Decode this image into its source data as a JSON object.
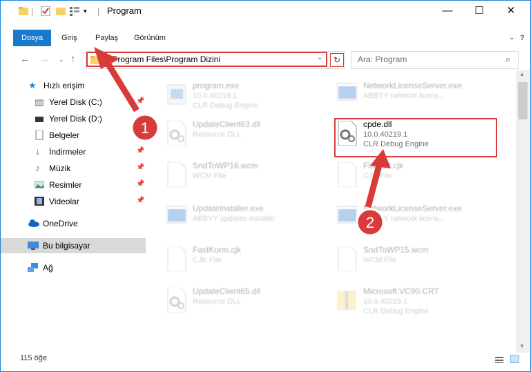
{
  "title": "Program",
  "tabs": [
    "Dosya",
    "Giriş",
    "Paylaş",
    "Görünüm"
  ],
  "window_buttons": {
    "minimize": "—",
    "maximize": "☐",
    "close": "✕"
  },
  "address": {
    "path": "C:\\Program Files\\Program Dizini"
  },
  "search": {
    "placeholder": "Ara: Program"
  },
  "sidebar": [
    {
      "label": "Hızlı erişim",
      "icon": "star-icon",
      "pinned": false
    },
    {
      "label": "Yerel Disk (C:)",
      "icon": "drive-icon",
      "pinned": true
    },
    {
      "label": "Yerel Disk (D:)",
      "icon": "drive-icon",
      "pinned": false
    },
    {
      "label": "Belgeler",
      "icon": "document-icon",
      "pinned": false
    },
    {
      "label": "İndirmeler",
      "icon": "download-icon",
      "pinned": true
    },
    {
      "label": "Müzik",
      "icon": "music-icon",
      "pinned": true
    },
    {
      "label": "Resimler",
      "icon": "pictures-icon",
      "pinned": true
    },
    {
      "label": "Videolar",
      "icon": "video-icon",
      "pinned": true
    },
    {
      "label": "OneDrive",
      "icon": "cloud-icon",
      "pinned": false
    },
    {
      "label": "Bu bilgisayar",
      "icon": "computer-icon",
      "pinned": false
    },
    {
      "label": "Ağ",
      "icon": "network-icon",
      "pinned": false
    }
  ],
  "files": [
    {
      "name": "program.exe",
      "line1": "10.0.40219.1",
      "line2": "CLR Debug Engine",
      "icon": "exe-icon"
    },
    {
      "name": "NetworkLicenseServer.exe",
      "line1": "ABBYY network licens...",
      "line2": "",
      "icon": "window-app-icon"
    },
    {
      "name": "UpdateClient63.dll",
      "line1": "Resource DLL",
      "line2": "",
      "icon": "gear-file-icon"
    },
    {
      "name": "cpde.dll",
      "line1": "10.0.40219.1",
      "line2": "CLR Debug Engine",
      "icon": "gear-file-icon"
    },
    {
      "name": "SndToWP16.wcm",
      "line1": "WCM File",
      "line2": "",
      "icon": "blank-file-icon"
    },
    {
      "name": "Flaroint.cjk",
      "line1": "CJK File",
      "line2": "",
      "icon": "blank-file-icon"
    },
    {
      "name": "UpdateInstaller.exe",
      "line1": "ABBYY updates installer",
      "line2": "",
      "icon": "window-app-icon"
    },
    {
      "name": "NetworkLicenseServer.exe",
      "line1": "ABBYY network licens...",
      "line2": "",
      "icon": "window-app-icon"
    },
    {
      "name": "FastKorm.cjk",
      "line1": "CJK File",
      "line2": "",
      "icon": "blank-file-icon"
    },
    {
      "name": "SndToWP15.wcm",
      "line1": "WCM File",
      "line2": "",
      "icon": "blank-file-icon"
    },
    {
      "name": "UpdateClient65.dll",
      "line1": "Resource DLL",
      "line2": "",
      "icon": "gear-file-icon"
    },
    {
      "name": "Microsoft.VC90.CRT",
      "line1": "10.0.40219.1",
      "line2": "CLR Debug Engine",
      "icon": "folder-zip-icon"
    }
  ],
  "status": {
    "count": "115 öğe"
  },
  "annotations": [
    {
      "number": "1"
    },
    {
      "number": "2"
    }
  ],
  "colors": {
    "accent": "#1979ca",
    "highlight": "#d93a3a"
  }
}
